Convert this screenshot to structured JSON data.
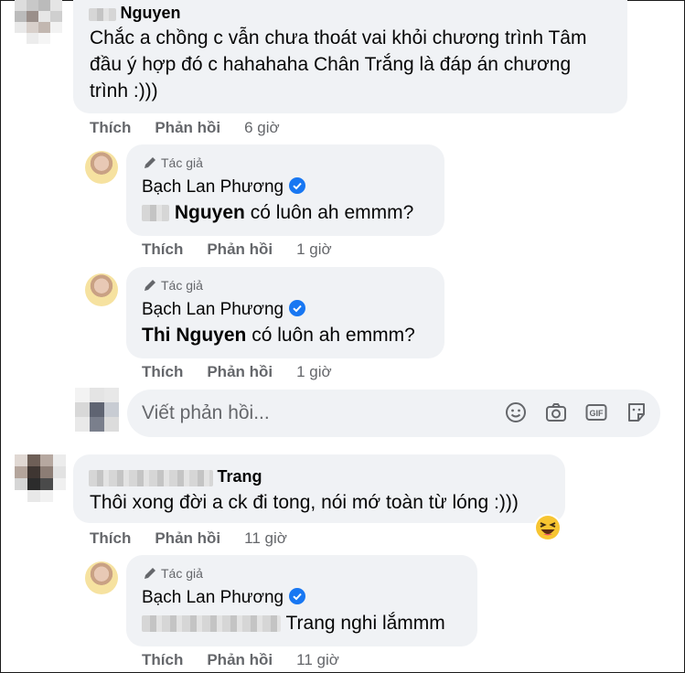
{
  "comment1": {
    "author": "Nguyen",
    "text_line1": "Chắc a chồng c vẫn chưa thoát vai khỏi chương trình Tâm",
    "text_line2": "đầu ý hợp đó c hahahaha Chân Trắng là đáp án chương",
    "text_line3": "trình :)))",
    "like_label": "Thích",
    "reply_label": "Phản hồi",
    "time": "6 giờ"
  },
  "reply1": {
    "author_badge": "Tác giả",
    "author_name": "Bạch Lan Phương",
    "mention": "Nguyen",
    "text": "có luôn ah emmm?",
    "like_label": "Thích",
    "reply_label": "Phản hồi",
    "time": "1 giờ"
  },
  "reply2": {
    "author_badge": "Tác giả",
    "author_name": "Bạch Lan Phương",
    "mention": "Thi Nguyen",
    "text": "có luôn ah emmm?",
    "like_label": "Thích",
    "reply_label": "Phản hồi",
    "time": "1 giờ"
  },
  "composer": {
    "placeholder": "Viết phản hồi...",
    "icons": [
      "smiley-icon",
      "camera-icon",
      "gif-icon",
      "sticker-icon"
    ]
  },
  "comment2": {
    "author": "Trang",
    "text": "Thôi xong đời a ck đi tong, nói mớ toàn từ lóng :)))",
    "reaction": "haha-emoji-icon",
    "like_label": "Thích",
    "reply_label": "Phản hồi",
    "time": "11 giờ"
  },
  "reply3": {
    "author_badge": "Tác giả",
    "author_name": "Bạch Lan Phương",
    "mention": "Trang",
    "text": "nghi lắmmm",
    "like_label": "Thích",
    "reply_label": "Phản hồi",
    "time": "11 giờ"
  },
  "colors": {
    "bubble": "#f0f2f5",
    "meta_text": "#65676b",
    "verified": "#1877f2",
    "text": "#050505"
  }
}
